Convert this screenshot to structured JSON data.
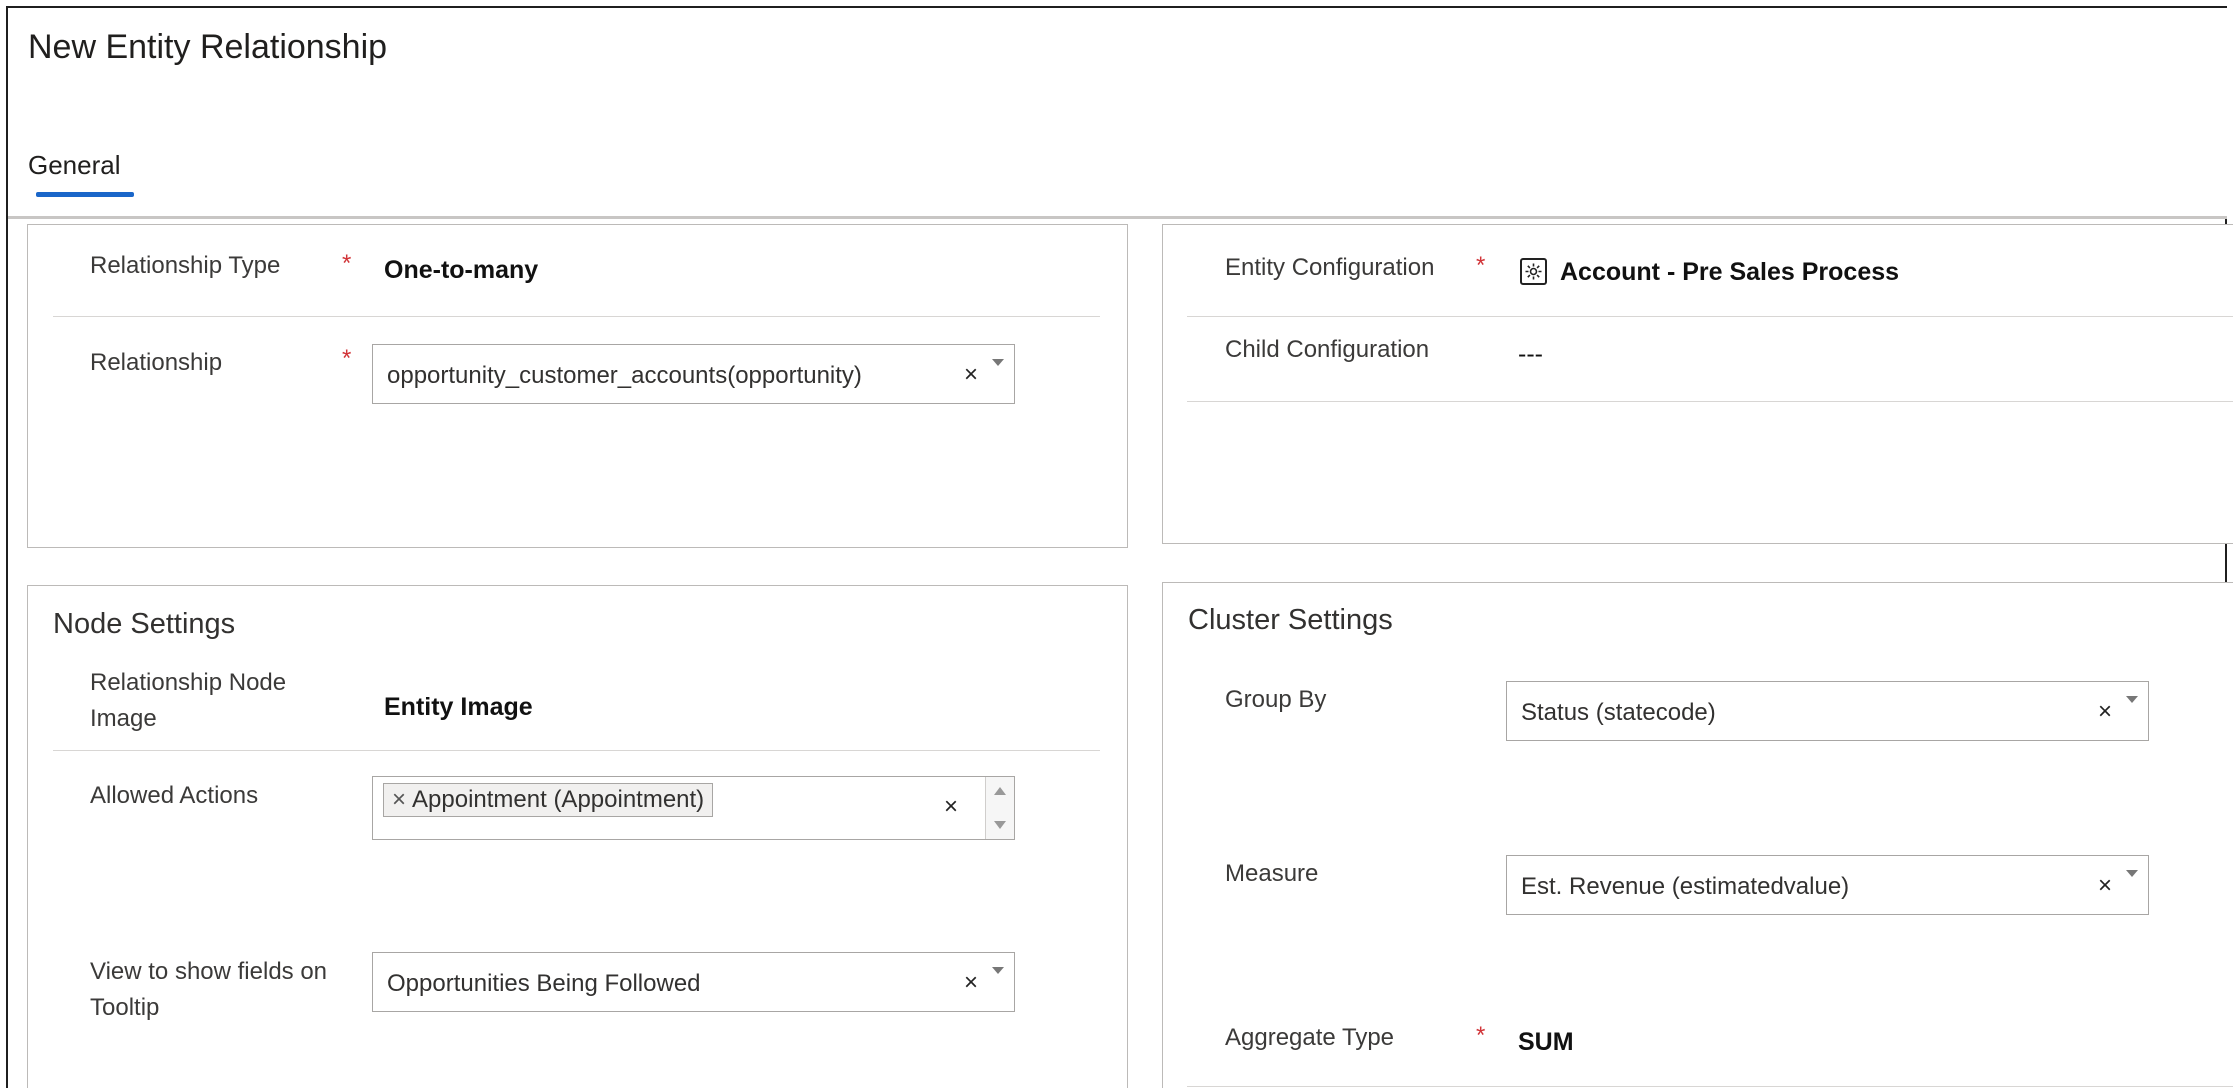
{
  "window": {
    "title": "New Entity Relationship"
  },
  "tabs": [
    {
      "label": "General"
    }
  ],
  "relationship_section": {
    "relationship_type": {
      "label": "Relationship Type",
      "value": "One-to-many"
    },
    "relationship": {
      "label": "Relationship",
      "value": "opportunity_customer_accounts(opportunity)"
    }
  },
  "configuration_section": {
    "entity_configuration": {
      "label": "Entity Configuration",
      "value": "Account - Pre Sales Process",
      "icon": "entity-config-icon"
    },
    "child_configuration": {
      "label": "Child Configuration",
      "value": "---"
    }
  },
  "node_settings": {
    "title": "Node Settings",
    "relationship_node_image": {
      "label": "Relationship Node Image",
      "value": "Entity Image"
    },
    "allowed_actions": {
      "label": "Allowed Actions",
      "tags": [
        "Appointment (Appointment)"
      ]
    },
    "tooltip_view": {
      "label": "View to show fields on Tooltip",
      "value": "Opportunities Being Followed"
    }
  },
  "cluster_settings": {
    "title": "Cluster Settings",
    "group_by": {
      "label": "Group By",
      "value": "Status (statecode)"
    },
    "measure": {
      "label": "Measure",
      "value": "Est. Revenue (estimatedvalue)"
    },
    "aggregate_type": {
      "label": "Aggregate Type",
      "value": "SUM"
    }
  },
  "common": {
    "required_marker": "*",
    "clear_glyph": "×"
  },
  "colors": {
    "accent": "#1a66c9",
    "required": "#d13438"
  }
}
